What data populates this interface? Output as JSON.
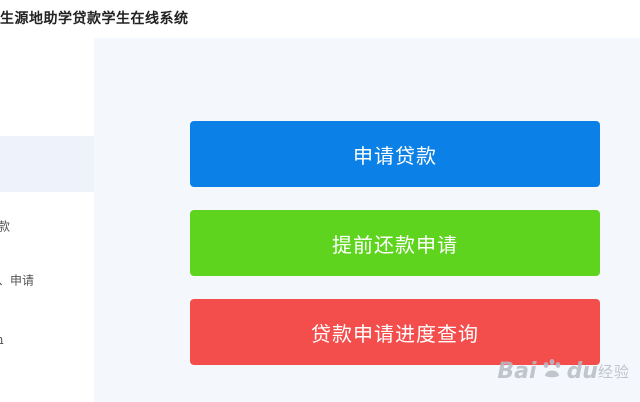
{
  "app": {
    "title": "生源地助学贷款学生在线系统"
  },
  "sidebar": {
    "items": [
      {
        "label": ""
      },
      {
        "label": "款"
      },
      {
        "label": "、申请"
      },
      {
        "label": "ɿ"
      }
    ]
  },
  "main": {
    "buttons": [
      {
        "label": "申请贷款",
        "color": "#0b80e6"
      },
      {
        "label": "提前还款申请",
        "color": "#5fd41f"
      },
      {
        "label": "贷款申请进度查询",
        "color": "#f34d4c"
      }
    ]
  },
  "watermark": {
    "logo": "Bai",
    "logo_suffix": "du",
    "text": "经验",
    "icon": "baidu-paw-icon"
  },
  "colors": {
    "content_bg": "#f4f7fb",
    "sidebar_active_bg": "#eef3fb"
  }
}
